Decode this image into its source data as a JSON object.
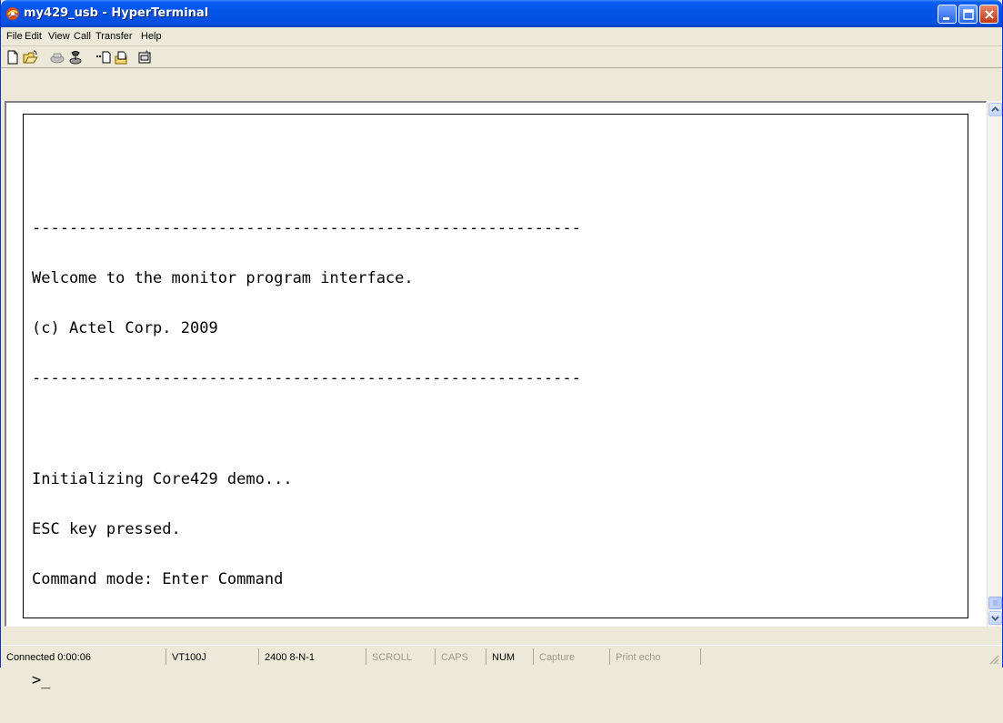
{
  "window": {
    "title": "my429_usb - HyperTerminal"
  },
  "menu": [
    "File",
    "Edit",
    "View",
    "Call",
    "Transfer",
    "Help"
  ],
  "toolbar": {
    "icons": [
      "new-connection-icon",
      "open-icon",
      "disconnect-icon",
      "dial-icon",
      "send-icon",
      "receive-icon",
      "properties-icon"
    ]
  },
  "terminal": {
    "lines": [
      "-----------------------------------------------------------",
      "Welcome to the monitor program interface.",
      "(c) Actel Corp. 2009",
      "-----------------------------------------------------------",
      "",
      "Initializing Core429 demo...",
      "ESC key pressed.",
      "Command mode: Enter Command",
      "",
      ">_"
    ]
  },
  "status": {
    "connected": "Connected 0:00:06",
    "emulation": "VT100J",
    "port_settings": "2400 8-N-1",
    "scroll": "SCROLL",
    "caps": "CAPS",
    "num": "NUM",
    "capture": "Capture",
    "print_echo": "Print echo"
  },
  "colors": {
    "titlebar": "#0353E7",
    "background": "#ECE9D8",
    "terminal_bg": "#FFFFFF",
    "terminal_fg": "#000000"
  }
}
